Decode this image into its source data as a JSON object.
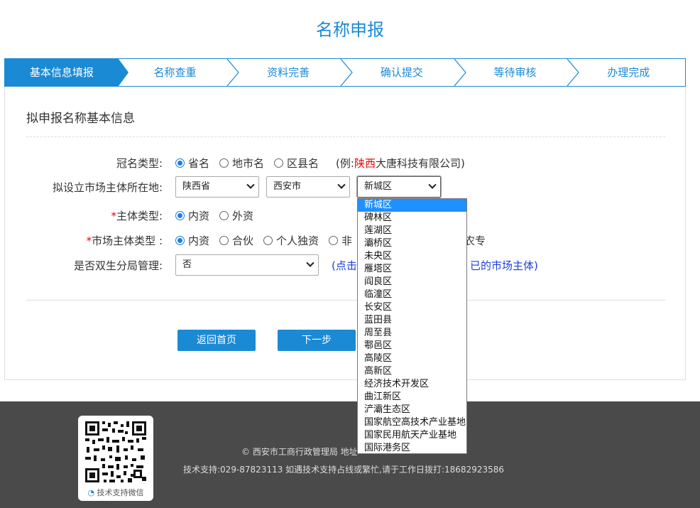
{
  "page_title": "名称申报",
  "steps": [
    "基本信息填报",
    "名称查重",
    "资料完善",
    "确认提交",
    "等待审核",
    "办理完成"
  ],
  "section_title": "拟申报名称基本信息",
  "rows": {
    "crown_type": {
      "label": "冠名类型:",
      "options": [
        "省名",
        "地市名",
        "区县名"
      ],
      "selected": "省名",
      "example_prefix": "(例:",
      "example_highlight": "陕西",
      "example_suffix": "大唐科技有限公司)"
    },
    "location": {
      "label": "拟设立市场主体所在地:",
      "province": "陕西省",
      "city": "西安市",
      "district": "新城区"
    },
    "subject_type": {
      "required_mark": "*",
      "label": "主体类型:",
      "options": [
        "内资",
        "外资"
      ],
      "selected": "内资"
    },
    "market_subject_type": {
      "required_mark": "*",
      "label": "市场主体类型 :",
      "options": [
        "内资",
        "合伙",
        "个人独资",
        "非"
      ],
      "trailing_text": "农专",
      "selected": "内资"
    },
    "dual_sub_bureau": {
      "label": "是否双生分局管理:",
      "value": "否",
      "note_left": "(点击",
      "note_right": "已的市场主体)"
    }
  },
  "buttons": {
    "home": "返回首页",
    "next": "下一步"
  },
  "dropdown_options": [
    "新城区",
    "碑林区",
    "莲湖区",
    "灞桥区",
    "未央区",
    "雁塔区",
    "阎良区",
    "临潼区",
    "长安区",
    "蓝田县",
    "周至县",
    "鄠邑区",
    "高陵区",
    "高新区",
    "经济技术开发区",
    "曲江新区",
    "浐灞生态区",
    "国家航空高技术产业基地",
    "国家民用航天产业基地",
    "国际港务区"
  ],
  "footer": {
    "qr_caption": "技术支持微信",
    "line1": "© 西安市工商行政管理局 地址",
    "line2": "技术支持:029-87823113 如遇技术支持占线或繁忙,请于工作日拨打:18682923586"
  },
  "colors": {
    "accent": "#1a8ad4",
    "required": "#e00000",
    "link": "#1c3fdc",
    "footer_bg": "#4a4a4a"
  }
}
